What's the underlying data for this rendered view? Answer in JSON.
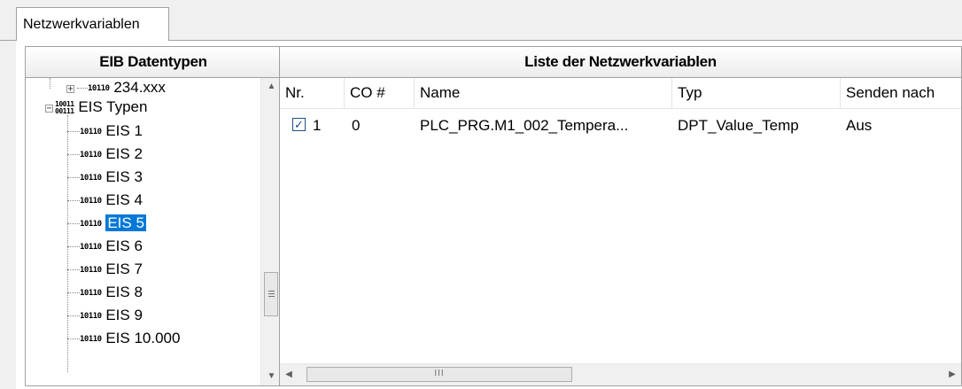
{
  "tab": {
    "label": "Netzwerkvariablen"
  },
  "left_panel": {
    "header": "EIB Datentypen",
    "tree": [
      {
        "icon": "10110",
        "label": "234.xxx",
        "expander": "+"
      },
      {
        "icon": "10011 00111",
        "label": "EIS Typen",
        "expander": "−"
      },
      {
        "icon": "10110",
        "label": "EIS 1"
      },
      {
        "icon": "10110",
        "label": "EIS 2"
      },
      {
        "icon": "10110",
        "label": "EIS 3"
      },
      {
        "icon": "10110",
        "label": "EIS 4"
      },
      {
        "icon": "10110",
        "label": "EIS 5",
        "selected": true
      },
      {
        "icon": "10110",
        "label": "EIS 6"
      },
      {
        "icon": "10110",
        "label": "EIS 7"
      },
      {
        "icon": "10110",
        "label": "EIS 8"
      },
      {
        "icon": "10110",
        "label": "EIS 9"
      },
      {
        "icon": "10110",
        "label": "EIS 10.000"
      }
    ]
  },
  "right_panel": {
    "header": "Liste der Netzwerkvariablen",
    "columns": [
      "Nr.",
      "CO #",
      "Name",
      "Typ",
      "Senden nach"
    ],
    "rows": [
      {
        "checked": true,
        "nr": "1",
        "co": "0",
        "name": "PLC_PRG.M1_002_Tempera...",
        "typ": "DPT_Value_Temp",
        "senden": "Aus"
      }
    ]
  },
  "icons": {
    "scroll_up": "scroll-up-arrow-icon",
    "scroll_down": "scroll-down-arrow-icon",
    "scroll_left": "scroll-left-arrow-icon",
    "scroll_right": "scroll-right-arrow-icon",
    "selection_color": "#0078d7"
  }
}
